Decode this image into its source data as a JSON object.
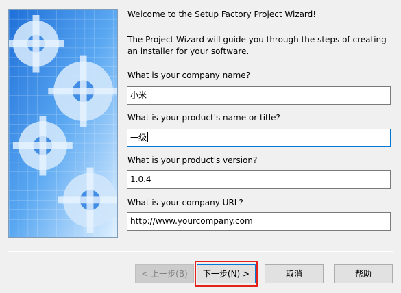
{
  "wizard": {
    "welcome": "Welcome to the Setup Factory Project Wizard!",
    "intro_line1": "The Project Wizard will guide you through the steps of creating",
    "intro_line2": "an installer for your software."
  },
  "fields": [
    {
      "label": "What is your company name?",
      "value": "小米"
    },
    {
      "label": "What is your product's name or title?",
      "value": "一级"
    },
    {
      "label": "What is your product's version?",
      "value": "1.0.4"
    },
    {
      "label": "What is your company URL?",
      "value": "http://www.yourcompany.com"
    }
  ],
  "buttons": {
    "back": "< 上一步(B)",
    "next": "下一步(N) >",
    "cancel": "取消",
    "help": "帮助"
  },
  "colors": {
    "banner_blue": "#2a7fe0",
    "highlight_red": "#e4221b",
    "focus_blue": "#0078d7"
  }
}
